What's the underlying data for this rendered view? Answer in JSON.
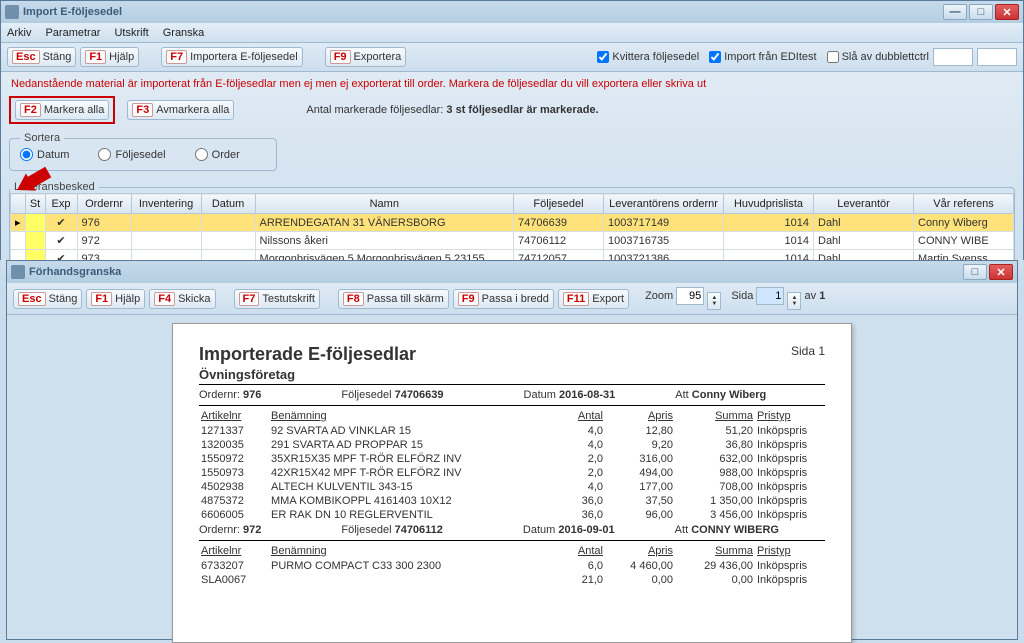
{
  "main": {
    "title": "Import E-följesedel",
    "menu": [
      "Arkiv",
      "Parametrar",
      "Utskrift",
      "Granska"
    ],
    "buttons": {
      "esc": {
        "key": "Esc",
        "label": "Stäng"
      },
      "f1": {
        "key": "F1",
        "label": "Hjälp"
      },
      "f7": {
        "key": "F7",
        "label": "Importera E-följesedel"
      },
      "f9": {
        "key": "F9",
        "label": "Exportera"
      },
      "f2": {
        "key": "F2",
        "label": "Markera alla"
      },
      "f3": {
        "key": "F3",
        "label": "Avmarkera alla"
      }
    },
    "checks": {
      "kvittera": "Kvittera följesedel",
      "editest": "Import från EDItest",
      "dubblett": "Slå av dubblettctrl"
    },
    "info": "Nedanstående material är importerat från E-följesedlar men ej  men ej exporterat till order. Markera de följesedlar du vill exportera eller skriva ut",
    "count_label": "Antal markerade följesedlar:",
    "count_value": "3 st följesedlar är markerade.",
    "sort": {
      "legend": "Sortera",
      "datum": "Datum",
      "foljesedel": "Följesedel",
      "order": "Order"
    },
    "grid": {
      "legend": "Leveransbesked",
      "headers": [
        "St",
        "Exp",
        "Ordernr",
        "Inventering",
        "Datum",
        "Namn",
        "Följesedel",
        "Leverantörens ordernr",
        "Huvudprislista",
        "Leverantör",
        "Vår referens"
      ],
      "rows": [
        {
          "ordernr": "976",
          "namn": "ARRENDEGATAN 31 VÄNERSBORG",
          "folj": "74706639",
          "levord": "1003717149",
          "prislista": "1014",
          "lev": "Dahl",
          "ref": "Conny Wiberg"
        },
        {
          "ordernr": "972",
          "namn": "Nilssons åkeri",
          "folj": "74706112",
          "levord": "1003716735",
          "prislista": "1014",
          "lev": "Dahl",
          "ref": "CONNY WIBE"
        },
        {
          "ordernr": "973",
          "namn": "Morgonbrisvägen   5 Morgonbrisvägen   5 23155",
          "folj": "74712057",
          "levord": "1003721386",
          "prislista": "1014",
          "lev": "Dahl",
          "ref": "Martin Svenss"
        }
      ]
    }
  },
  "preview": {
    "title": "Förhandsgranska",
    "buttons": {
      "esc": {
        "key": "Esc",
        "label": "Stäng"
      },
      "f1": {
        "key": "F1",
        "label": "Hjälp"
      },
      "f4": {
        "key": "F4",
        "label": "Skicka"
      },
      "f7": {
        "key": "F7",
        "label": "Testutskrift"
      },
      "f8": {
        "key": "F8",
        "label": "Passa till skärm"
      },
      "f9": {
        "key": "F9",
        "label": "Passa i bredd"
      },
      "f11": {
        "key": "F11",
        "label": "Export"
      }
    },
    "zoom_label": "Zoom",
    "zoom_value": "95",
    "sida_label": "Sida",
    "sida_value": "1",
    "av_label": "av",
    "av_value": "1",
    "report": {
      "title": "Importerade E-följesedlar",
      "subtitle": "Övningsföretag",
      "side": "Sida 1",
      "orders": [
        {
          "ordernr_l": "Ordernr:",
          "ordernr": "976",
          "folj_l": "Följesedel",
          "folj": "74706639",
          "datum_l": "Datum",
          "datum": "2016-08-31",
          "att_l": "Att",
          "att": "Conny Wiberg",
          "hdr": {
            "art": "Artikelnr",
            "ben": "Benämning",
            "antal": "Antal",
            "apris": "Apris",
            "summa": "Summa",
            "pristyp": "Pristyp"
          },
          "lines": [
            {
              "art": "1271337",
              "ben": "92 SVARTA AD VINKLAR 15",
              "antal": "4,0",
              "apris": "12,80",
              "summa": "51,20",
              "pris": "Inköpspris"
            },
            {
              "art": "1320035",
              "ben": "291 SVARTA AD PROPPAR 15",
              "antal": "4,0",
              "apris": "9,20",
              "summa": "36,80",
              "pris": "Inköpspris"
            },
            {
              "art": "1550972",
              "ben": "35XR15X35 MPF T-RÖR ELFÖRZ INV",
              "antal": "2,0",
              "apris": "316,00",
              "summa": "632,00",
              "pris": "Inköpspris"
            },
            {
              "art": "1550973",
              "ben": "42XR15X42 MPF T-RÖR ELFÖRZ INV",
              "antal": "2,0",
              "apris": "494,00",
              "summa": "988,00",
              "pris": "Inköpspris"
            },
            {
              "art": "4502938",
              "ben": "ALTECH KULVENTIL 343-15",
              "antal": "4,0",
              "apris": "177,00",
              "summa": "708,00",
              "pris": "Inköpspris"
            },
            {
              "art": "4875372",
              "ben": "MMA KOMBIKOPPL 4161403 10X12",
              "antal": "36,0",
              "apris": "37,50",
              "summa": "1 350,00",
              "pris": "Inköpspris"
            },
            {
              "art": "6606005",
              "ben": "ER RAK DN 10 REGLERVENTIL",
              "antal": "36,0",
              "apris": "96,00",
              "summa": "3 456,00",
              "pris": "Inköpspris"
            }
          ]
        },
        {
          "ordernr_l": "Ordernr:",
          "ordernr": "972",
          "folj_l": "Följesedel",
          "folj": "74706112",
          "datum_l": "Datum",
          "datum": "2016-09-01",
          "att_l": "Att",
          "att": "CONNY WIBERG",
          "hdr": {
            "art": "Artikelnr",
            "ben": "Benämning",
            "antal": "Antal",
            "apris": "Apris",
            "summa": "Summa",
            "pristyp": "Pristyp"
          },
          "lines": [
            {
              "art": "6733207",
              "ben": "PURMO COMPACT C33 300 2300",
              "antal": "6,0",
              "apris": "4 460,00",
              "summa": "29 436,00",
              "pris": "Inköpspris"
            },
            {
              "art": "SLA0067",
              "ben": "",
              "antal": "21,0",
              "apris": "0,00",
              "summa": "0,00",
              "pris": "Inköpspris"
            }
          ]
        }
      ]
    }
  }
}
